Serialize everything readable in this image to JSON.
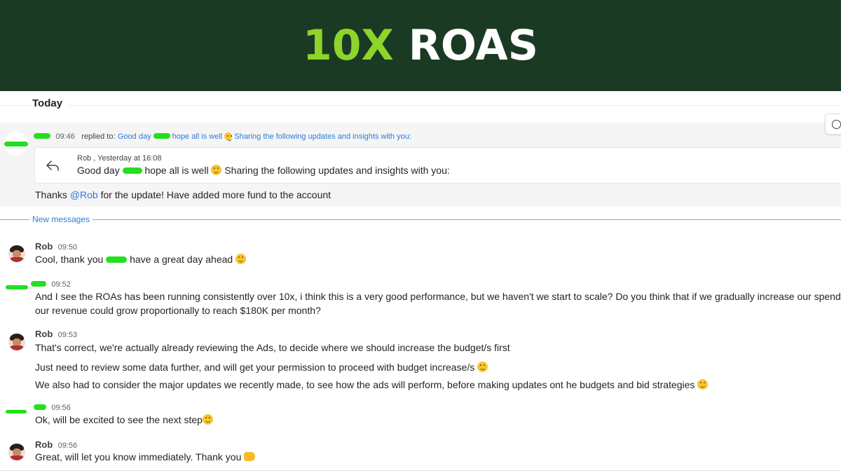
{
  "banner": {
    "title_accent": "10X",
    "title_rest": "ROAS",
    "accent_color": "#8ed42a",
    "background_color": "#1b3a24"
  },
  "chat": {
    "day_label": "Today",
    "new_messages_label": "New messages",
    "reply_message": {
      "time": "09:46",
      "replied_to_prefix": "replied to:",
      "replied_to_text_a": "Good day",
      "replied_to_text_b": "hope all is well",
      "replied_to_text_c": "Sharing the following updates and insights with you:",
      "quote_author": "Rob , Yesterday at 16:08",
      "quote_text_a": "Good day",
      "quote_text_b": "hope all is well",
      "quote_text_c": "Sharing the following updates and insights with you:",
      "body_a": "Thanks",
      "body_mention": "@Rob",
      "body_b": "for the update! Have added more fund to the account"
    },
    "messages": [
      {
        "sender": "Rob",
        "time": "09:50",
        "lines": [
          "Cool, thank you",
          "have a great day ahead"
        ]
      },
      {
        "sender": "",
        "time": "09:52",
        "lines": [
          "And I see the ROAs has been running consistently over 10x, i think this is a very good performance, but we haven't we start to scale? Do you think that if we gradually increase our spendi",
          "our revenue could grow proportionally to reach $180K per month?"
        ]
      },
      {
        "sender": "Rob",
        "time": "09:53",
        "lines": [
          "That's correct, we're actually already reviewing the Ads, to decide where we should increase the budget/s first",
          "Just need to review some data further, and will get your permission to proceed with budget increase/s",
          "We also had to consider the major updates we recently made, to see how the ads will perform, before making updates ont he budgets and bid strategies"
        ]
      },
      {
        "sender": "",
        "time": "09:56",
        "lines": [
          "Ok, will be excited to see the next step"
        ]
      },
      {
        "sender": "Rob",
        "time": "09:56",
        "lines": [
          "Great, will let you know immediately. Thank you"
        ]
      }
    ]
  },
  "icons": {
    "reply": "reply-arrow-icon",
    "react": "smiley-reaction-icon",
    "emoji": "smiling-face-emoji",
    "fist": "fist-bump-emoji"
  }
}
